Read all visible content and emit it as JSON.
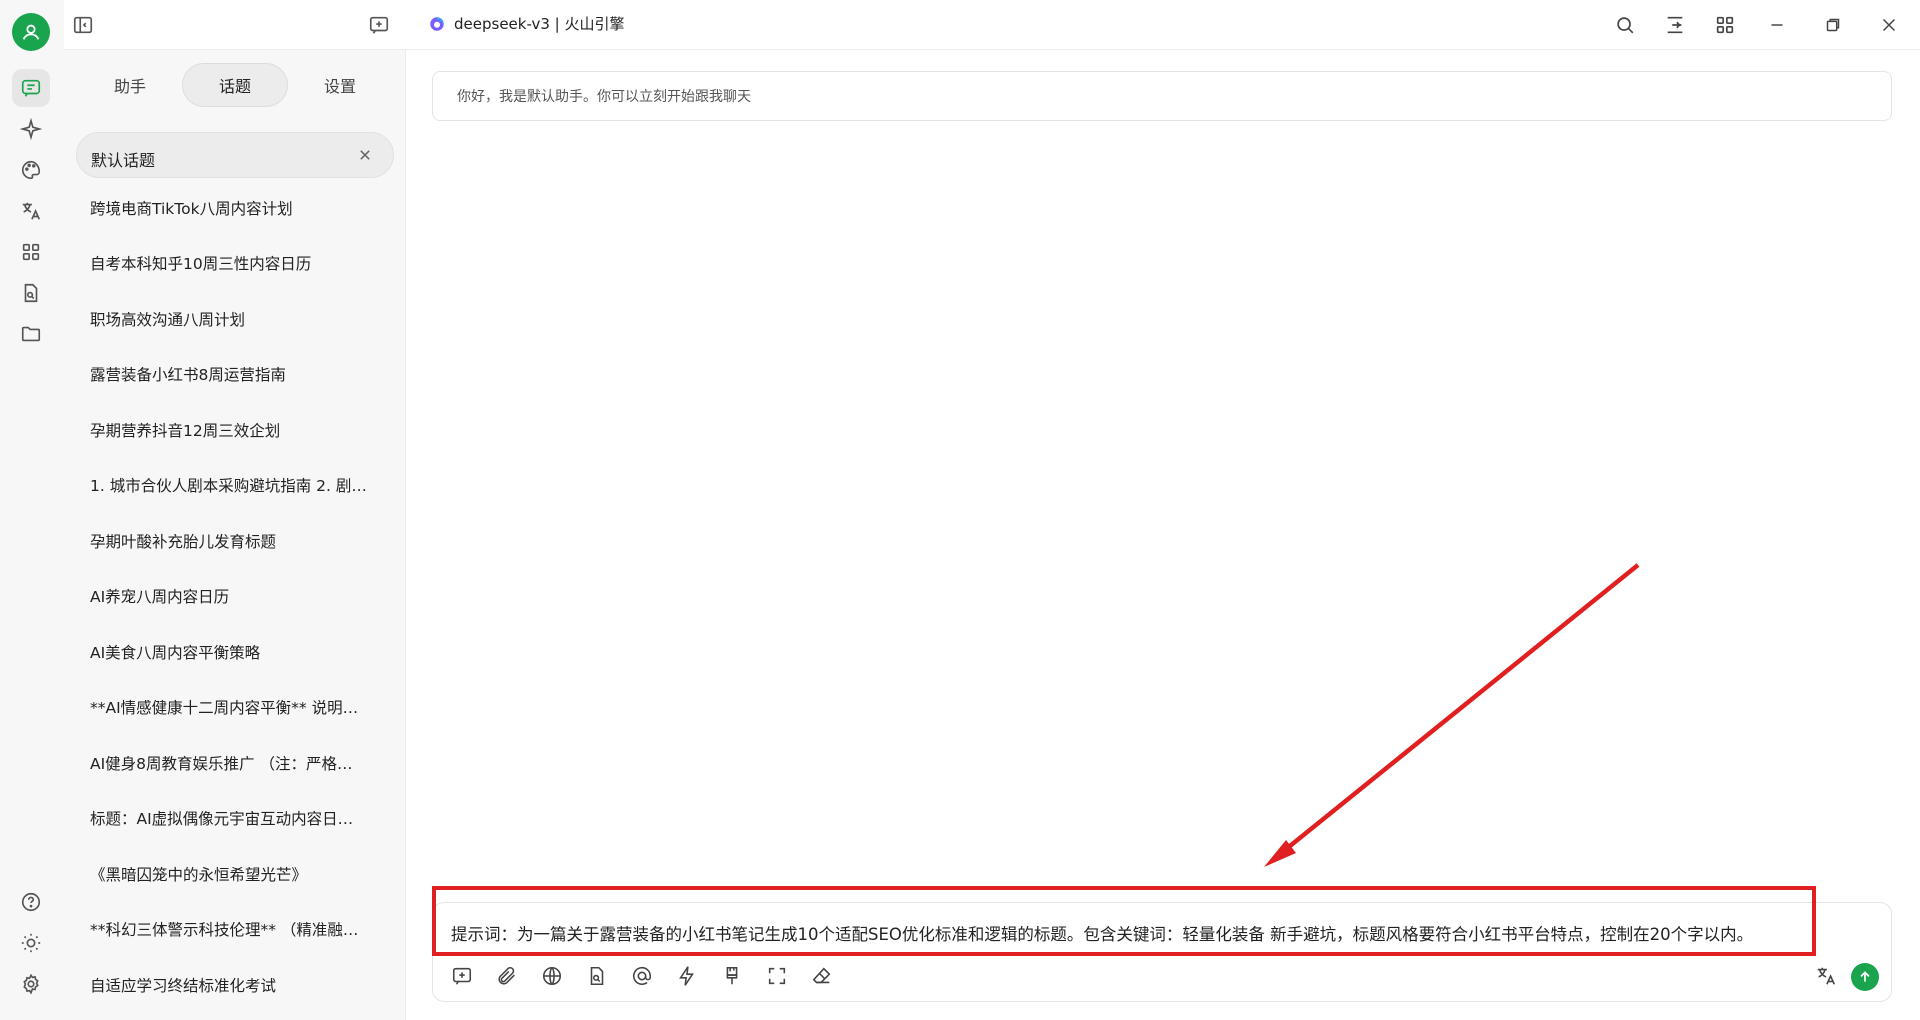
{
  "window": {
    "title": "deepseek-v3 | 火山引擎"
  },
  "sidebar": {
    "tabs": [
      {
        "label": "助手",
        "active": false
      },
      {
        "label": "话题",
        "active": true
      },
      {
        "label": "设置",
        "active": false
      }
    ],
    "current_topic": "默认话题",
    "topics": [
      "跨境电商TikTok八周内容计划",
      "自考本科知乎10周三性内容日历",
      "职场高效沟通八周计划",
      "露营装备小红书8周运营指南",
      "孕期营养抖音12周三效企划",
      "1. 城市合伙人剧本采购避坑指南 2. 剧…",
      "孕期叶酸补充胎儿发育标题",
      "AI养宠八周内容日历",
      "AI美食八周内容平衡策略",
      "**AI情感健康十二周内容平衡** 说明…",
      "AI健身8周教育娱乐推广 （注：严格…",
      "标题：AI虚拟偶像元宇宙互动内容日…",
      "《黑暗囚笼中的永恒希望光芒》",
      "**科幻三体警示科技伦理** （精准融…",
      "自适应学习终结标准化考试"
    ]
  },
  "main": {
    "greeting": "你好，我是默认助手。你可以立刻开始跟我聊天",
    "composer": {
      "text": "提示词：为一篇关于露营装备的小红书笔记生成10个适配SEO优化标准和逻辑的标题。包含关键词：轻量化装备 新手避坑，标题风格要符合小红书平台特点，控制在20个字以内。"
    }
  },
  "colors": {
    "brand_green": "#1aa44e",
    "annotation_red": "#e02020"
  }
}
